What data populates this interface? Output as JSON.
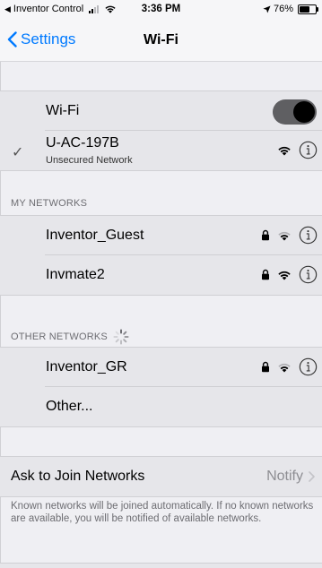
{
  "status_bar": {
    "back_app": "Inventor Control",
    "time": "3:36 PM",
    "battery_percent": "76%",
    "battery_level": 0.76,
    "signal_bars_filled": 2,
    "signal_bars_total": 4
  },
  "nav": {
    "back_label": "Settings",
    "title": "Wi-Fi"
  },
  "wifi_toggle": {
    "label": "Wi-Fi",
    "on": true
  },
  "connected_network": {
    "ssid": "U-AC-197B",
    "security_note": "Unsecured Network"
  },
  "my_networks": {
    "header": "MY NETWORKS",
    "items": [
      {
        "ssid": "Inventor_Guest",
        "locked": true
      },
      {
        "ssid": "Invmate2",
        "locked": true
      }
    ]
  },
  "other_networks": {
    "header": "OTHER NETWORKS",
    "items": [
      {
        "ssid": "Inventor_GR",
        "locked": true
      },
      {
        "ssid": "Other..."
      }
    ]
  },
  "ask_to_join": {
    "label": "Ask to Join Networks",
    "value": "Notify",
    "description": "Known networks will be joined automatically. If no known networks are available, you will be notified of available networks."
  },
  "colors": {
    "accent": "#007aff",
    "group_bg": "#e6e6ea",
    "toggle_on": "#5f5f62"
  }
}
